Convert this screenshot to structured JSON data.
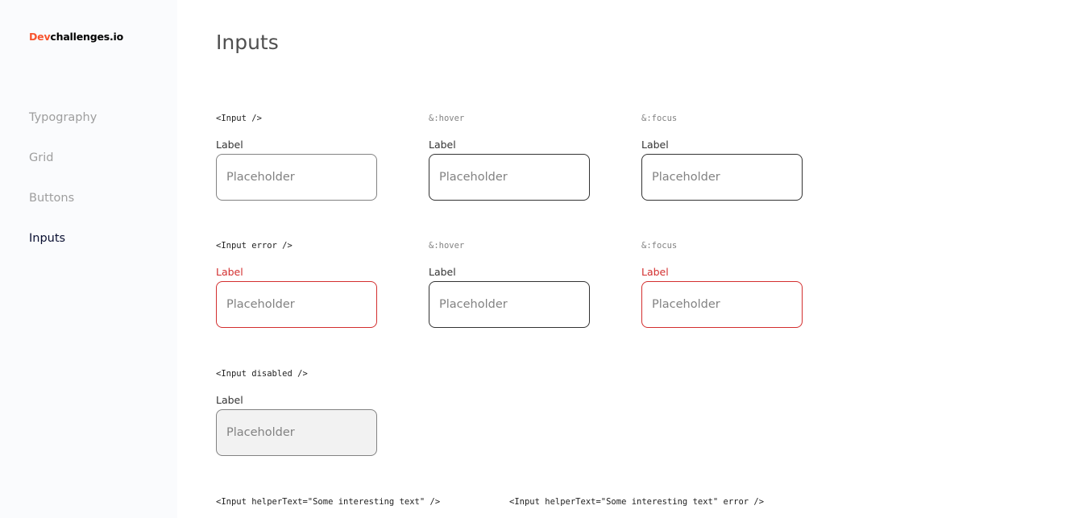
{
  "sidebar": {
    "logo_dev": "Dev",
    "logo_rest": "challenges.io",
    "items": [
      {
        "label": "Typography"
      },
      {
        "label": "Grid"
      },
      {
        "label": "Buttons"
      },
      {
        "label": "Inputs"
      }
    ]
  },
  "page": {
    "title": "Inputs"
  },
  "rows": {
    "default": {
      "code": "<Input />",
      "hover_code": "&:hover",
      "focus_code": "&:focus",
      "label": "Label",
      "placeholder": "Placeholder"
    },
    "error": {
      "code": "<Input error />",
      "hover_code": "&:hover",
      "focus_code": "&:focus",
      "label": "Label",
      "placeholder": "Placeholder"
    },
    "disabled": {
      "code": "<Input disabled />",
      "label": "Label",
      "placeholder": "Placeholder"
    },
    "helper": {
      "code": "<Input helperText=\"Some interesting text\" />",
      "error_code": "<Input helperText=\"Some interesting text\" error />"
    }
  },
  "colors": {
    "accent_dev": "#f7542e",
    "error": "#d32f2f",
    "sidebar_bg": "#fafbfd",
    "disabled_bg": "#f2f2f2"
  }
}
